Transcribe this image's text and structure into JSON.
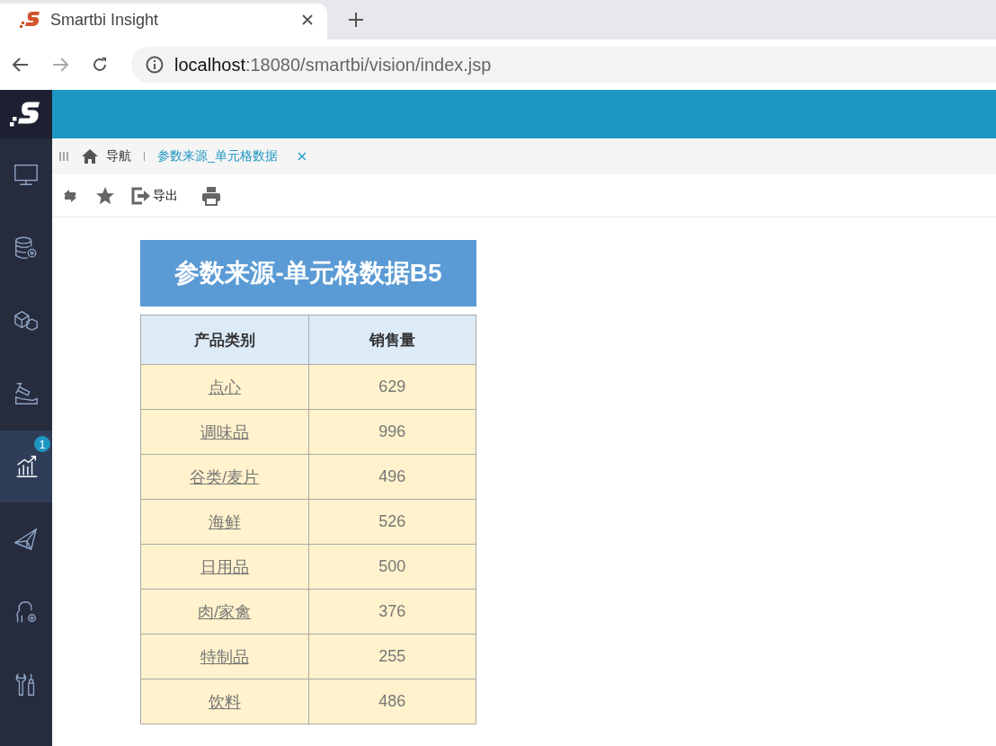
{
  "browser": {
    "tab_title": "Smartbi Insight",
    "url_host": "localhost",
    "url_path": ":18080/smartbi/vision/index.jsp"
  },
  "sidebar": {
    "items": [
      {
        "kind": "monitor",
        "selected": false
      },
      {
        "kind": "database",
        "selected": false
      },
      {
        "kind": "cubes",
        "selected": false
      },
      {
        "kind": "excavate",
        "selected": false
      },
      {
        "kind": "chart",
        "selected": true,
        "badge": "1"
      },
      {
        "kind": "plane",
        "selected": false
      },
      {
        "kind": "person",
        "selected": false
      },
      {
        "kind": "tools",
        "selected": false
      }
    ]
  },
  "tabs": [
    {
      "kind": "home",
      "label": "导航",
      "selected": false
    },
    {
      "kind": "page",
      "label": "参数来源_单元格数据",
      "selected": true,
      "closable": true
    }
  ],
  "toolbar": {
    "export_label": "导出"
  },
  "report": {
    "title": "参数来源-单元格数据B5",
    "columns": [
      "产品类别",
      "销售量"
    ],
    "rows": [
      {
        "category": "点心",
        "sales": "629"
      },
      {
        "category": "调味品",
        "sales": "996"
      },
      {
        "category": "谷类/麦片",
        "sales": "496"
      },
      {
        "category": "海鲜",
        "sales": "526"
      },
      {
        "category": "日用品",
        "sales": "500"
      },
      {
        "category": "肉/家禽",
        "sales": "376"
      },
      {
        "category": "特制品",
        "sales": "255"
      },
      {
        "category": "饮料",
        "sales": "486"
      }
    ]
  }
}
